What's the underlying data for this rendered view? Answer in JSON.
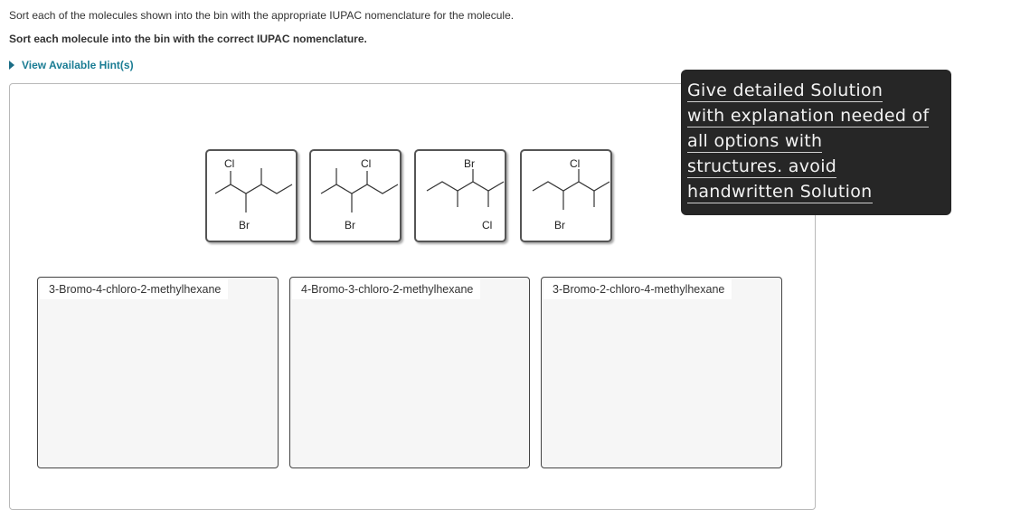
{
  "instructions": {
    "line1": "Sort each of the molecules shown into the bin with the appropriate IUPAC nomenclature for the molecule.",
    "line2": "Sort each molecule into the bin with the correct IUPAC nomenclature."
  },
  "hint": {
    "label": "View Available Hint(s)",
    "icon": "triangle-right-icon"
  },
  "molecules": [
    {
      "top_label": "Cl",
      "bottom_label": "Br"
    },
    {
      "top_label": "Cl",
      "bottom_label": "Br"
    },
    {
      "top_label": "Br",
      "bottom_label": "Cl"
    },
    {
      "top_label": "Cl",
      "bottom_label": "Br"
    }
  ],
  "bins": [
    {
      "title": "3-Bromo-4-chloro-2-methylhexane"
    },
    {
      "title": "4-Bromo-3-chloro-2-methylhexane"
    },
    {
      "title": "3-Bromo-2-chloro-4-methylhexane"
    }
  ],
  "note": {
    "lines": [
      "Give detailed Solution",
      "with explanation needed of",
      "all options with",
      "structures. avoid",
      "handwritten Solution"
    ]
  }
}
